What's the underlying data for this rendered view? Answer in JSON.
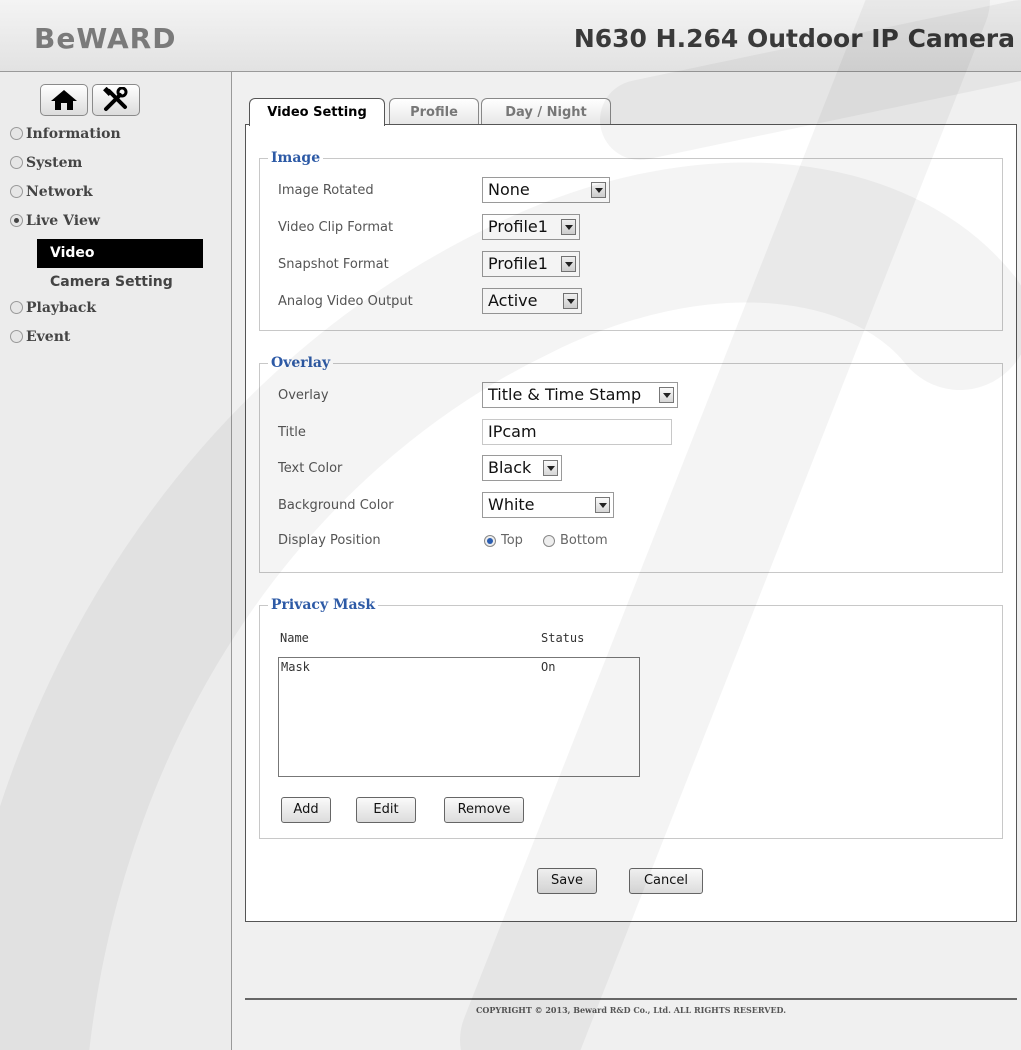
{
  "header": {
    "logo": "BeWARD",
    "title": "N630 H.264 Outdoor IP Camera"
  },
  "toolbar": {
    "home_icon": "home-icon",
    "settings_icon": "tools-icon"
  },
  "sidebar": {
    "items": [
      {
        "label": "Information"
      },
      {
        "label": "System"
      },
      {
        "label": "Network"
      },
      {
        "label": "Live View"
      },
      {
        "label": "Video"
      },
      {
        "label": "Camera Setting"
      },
      {
        "label": "Playback"
      },
      {
        "label": "Event"
      }
    ]
  },
  "tabs": [
    {
      "label": "Video Setting"
    },
    {
      "label": "Profile"
    },
    {
      "label": "Day / Night"
    }
  ],
  "image_section": {
    "legend": "Image",
    "image_rotated_label": "Image Rotated",
    "image_rotated_value": "None",
    "video_clip_label": "Video Clip Format",
    "video_clip_value": "Profile1",
    "snapshot_label": "Snapshot Format",
    "snapshot_value": "Profile1",
    "analog_label": "Analog Video Output",
    "analog_value": "Active"
  },
  "overlay_section": {
    "legend": "Overlay",
    "overlay_label": "Overlay",
    "overlay_value": "Title & Time Stamp",
    "title_label": "Title",
    "title_value": "IPcam",
    "text_color_label": "Text Color",
    "text_color_value": "Black",
    "bg_color_label": "Background Color",
    "bg_color_value": "White",
    "position_label": "Display Position",
    "pos_top": "Top",
    "pos_bottom": "Bottom"
  },
  "privacy_section": {
    "legend": "Privacy Mask",
    "col_name": "Name",
    "col_status": "Status",
    "rows": [
      {
        "name": "Mask",
        "status": "On"
      }
    ],
    "add_label": "Add",
    "edit_label": "Edit",
    "remove_label": "Remove"
  },
  "actions": {
    "save_label": "Save",
    "cancel_label": "Cancel"
  },
  "footer": {
    "copyright": "COPYRIGHT © 2013, Beward R&D Co., Ltd. ALL RIGHTS RESERVED."
  },
  "colors": {
    "legend": "#2d5aa6",
    "active_nav_bg": "#000000"
  }
}
